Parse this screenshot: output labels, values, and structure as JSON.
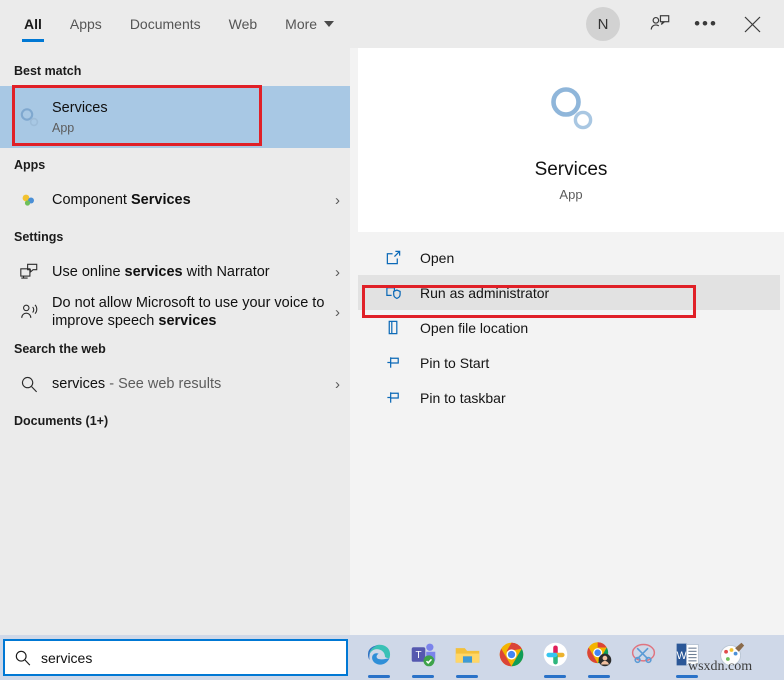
{
  "header": {
    "tabs": [
      {
        "label": "All",
        "active": true
      },
      {
        "label": "Apps",
        "active": false
      },
      {
        "label": "Documents",
        "active": false
      },
      {
        "label": "Web",
        "active": false
      },
      {
        "label": "More",
        "active": false,
        "caret": true
      }
    ],
    "avatar_initial": "N",
    "feedback_icon": "person-feedback-icon",
    "more_icon": "ellipsis-icon",
    "close_icon": "close-icon"
  },
  "left": {
    "best_match_header": "Best match",
    "best_match": {
      "title": "Services",
      "subtitle": "App",
      "icon": "services-gears-icon"
    },
    "apps_header": "Apps",
    "apps": [
      {
        "title_plain": "Component ",
        "title_bold": "Services",
        "icon": "component-services-icon",
        "chevron": "›"
      }
    ],
    "settings_header": "Settings",
    "settings": [
      {
        "pre": "Use online ",
        "bold": "services",
        "post": " with Narrator",
        "icon": "narrator-monitor-icon",
        "chevron": "›"
      },
      {
        "pre": "Do not allow Microsoft to use your voice to improve speech ",
        "bold": "services",
        "post": "",
        "icon": "voice-person-icon",
        "chevron": "›"
      }
    ],
    "web_header": "Search the web",
    "web": [
      {
        "query": "services",
        "suffix": " - See web results",
        "icon": "search-icon",
        "chevron": "›"
      }
    ],
    "documents_header": "Documents (1+)"
  },
  "right": {
    "preview": {
      "icon": "services-gears-icon",
      "title": "Services",
      "subtitle": "App"
    },
    "actions": [
      {
        "label": "Open",
        "icon": "open-external-icon",
        "hover": false
      },
      {
        "label": "Run as administrator",
        "icon": "shield-admin-icon",
        "hover": true
      },
      {
        "label": "Open file location",
        "icon": "folder-location-icon",
        "hover": false
      },
      {
        "label": "Pin to Start",
        "icon": "pin-icon",
        "hover": false
      },
      {
        "label": "Pin to taskbar",
        "icon": "pin-icon",
        "hover": false
      }
    ]
  },
  "taskbar": {
    "search_value": "services",
    "search_icon": "search-icon",
    "apps": [
      {
        "name": "microsoft-edge",
        "running": true
      },
      {
        "name": "microsoft-teams",
        "running": true
      },
      {
        "name": "file-explorer",
        "running": true
      },
      {
        "name": "google-chrome",
        "running": false
      },
      {
        "name": "slack",
        "running": true
      },
      {
        "name": "chrome-profile",
        "running": true
      },
      {
        "name": "snipping-tool",
        "running": false
      },
      {
        "name": "microsoft-word",
        "running": true
      },
      {
        "name": "paint",
        "running": false
      }
    ]
  },
  "annotations": {
    "best_match_box": "red-highlight-box",
    "run_as_admin_box": "red-highlight-box",
    "search_text_box": "red-highlight-box",
    "color": "#e02027"
  },
  "watermark": {
    "text": "wsxdn.com"
  }
}
